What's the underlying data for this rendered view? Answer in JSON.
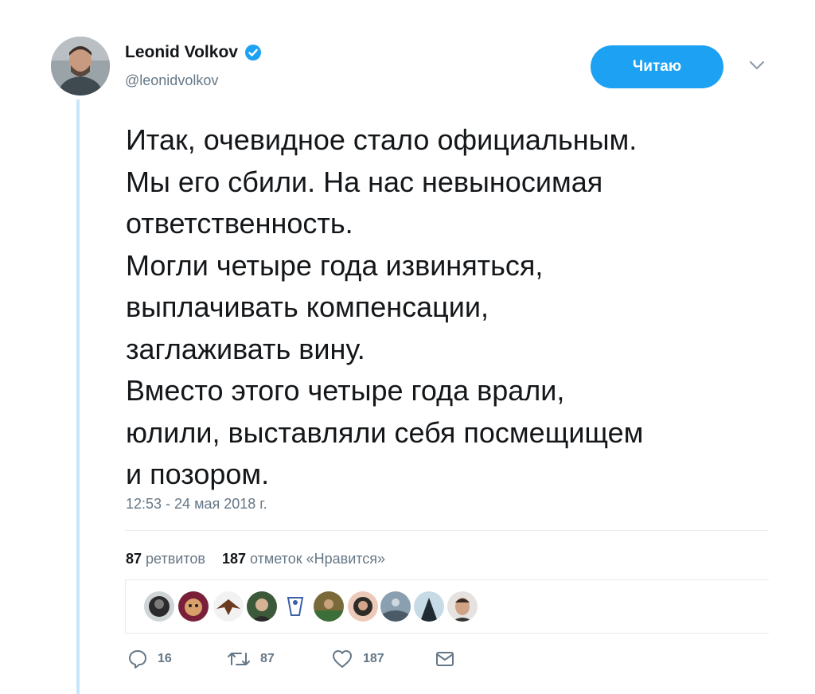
{
  "author": {
    "display_name": "Leonid Volkov",
    "handle": "@leonidvolkov",
    "verified": true
  },
  "follow_button": {
    "label": "Читаю",
    "color": "#1da1f2"
  },
  "tweet": {
    "lines": [
      "Итак, очевидное стало официальным.",
      "Мы его сбили. На нас невыносимая",
      "ответственность.",
      "Могли четыре года извиняться,",
      "выплачивать компенсации,",
      "заглаживать вину.",
      "Вместо этого четыре года врали,",
      "юлили, выставляли себя посмещищем",
      "и позором."
    ],
    "timestamp": "12:53 - 24 мая 2018 г."
  },
  "stats": {
    "retweets_count": "87",
    "retweets_label": "ретвитов",
    "likes_count": "187",
    "likes_label": "отметок «Нравится»"
  },
  "liker_avatars": 10,
  "actions": {
    "reply_count": "16",
    "retweet_count": "87",
    "like_count": "187"
  },
  "colors": {
    "accent": "#1da1f2",
    "thread_line": "#c8e6fb",
    "muted_text": "#657786"
  }
}
